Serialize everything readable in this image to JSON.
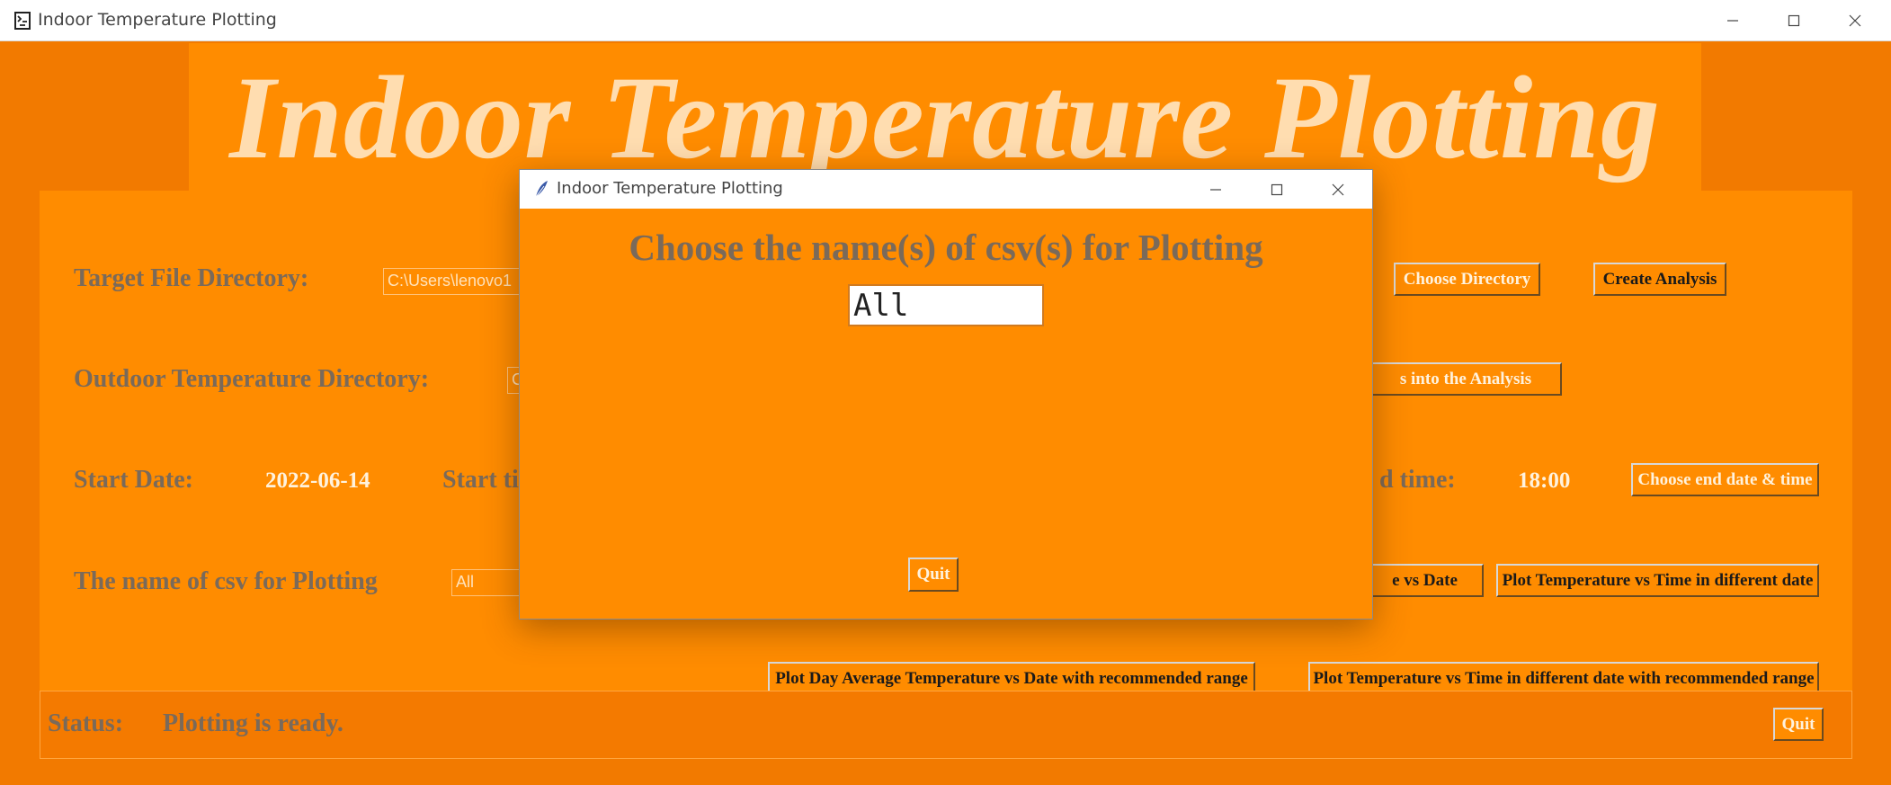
{
  "window": {
    "title": "Indoor Temperature Plotting"
  },
  "header": {
    "banner_text": "Indoor Temperature Plotting"
  },
  "form": {
    "target_dir_label": "Target File Directory:",
    "target_dir_value": "C:\\Users\\lenovo1",
    "outdoor_dir_label": "Outdoor Temperature Directory:",
    "outdoor_dir_value": "C",
    "start_date_label": "Start Date:",
    "start_date_value": "2022-06-14",
    "start_time_label": "Start ti",
    "end_time_label": "d time:",
    "end_time_value": "18:00",
    "csv_name_label": "The name of csv for Plotting",
    "csv_name_value": "All"
  },
  "buttons": {
    "choose_directory": "Choose Directory",
    "create_analysis": "Create Analysis",
    "include_analysis": "s into the Analysis",
    "choose_end": "Choose end date & time",
    "plot_vs_date": "e vs Date",
    "plot_temp_time": "Plot Temperature vs Time in different date",
    "plot_day_avg_range": "Plot Day Average Temperature vs Date with recommended range",
    "plot_temp_time_range": "Plot Temperature vs Time in different date with recommended range",
    "quit": "Quit"
  },
  "status": {
    "label": "Status:",
    "message": "Plotting is ready."
  },
  "dialog": {
    "title": "Indoor Temperature Plotting",
    "prompt": "Choose the name(s) of csv(s) for Plotting",
    "entry_value": "All",
    "quit_label": "Quit"
  },
  "colors": {
    "background": "#f27a00",
    "panel": "#ff8c00",
    "label_text": "#7a6a5a",
    "light_text": "#fff2dd",
    "banner_text": "#ffddb0"
  }
}
